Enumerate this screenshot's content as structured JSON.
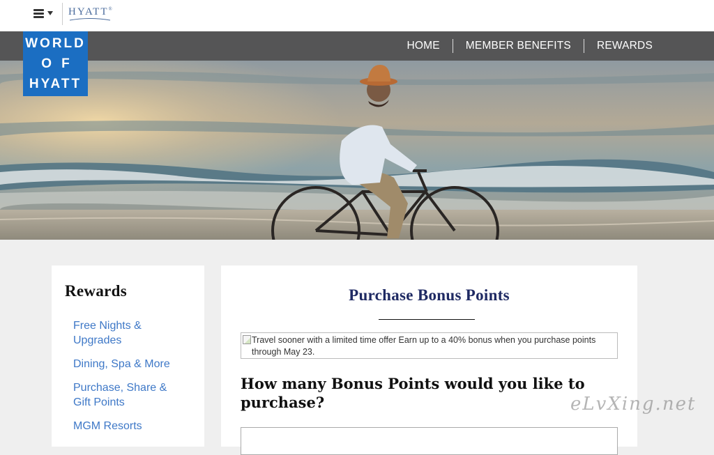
{
  "header": {
    "brand": "HYATT",
    "brand_tm": "®"
  },
  "logo": {
    "line1": "WORLD",
    "line2": "OF",
    "line3": "HYATT",
    "color": "#1b6ec2"
  },
  "nav": {
    "items": [
      "HOME",
      "MEMBER BENEFITS",
      "REWARDS"
    ]
  },
  "sidebar": {
    "title": "Rewards",
    "links": [
      "Free Nights & Upgrades",
      "Dining, Spa & More",
      "Purchase, Share & Gift Points",
      "MGM Resorts"
    ]
  },
  "main": {
    "title": "Purchase Bonus Points",
    "promo_alt_line1": "Travel sooner with a limited time offer Earn up to a 40% bonus when you purchase points",
    "promo_alt_line2": "through May 23.",
    "question": "How many Bonus Points would you like to purchase?"
  },
  "watermark": "eLvXing.net",
  "colors": {
    "nav_bg": "#555556",
    "link": "#3e78c7",
    "title": "#1f2a63"
  }
}
